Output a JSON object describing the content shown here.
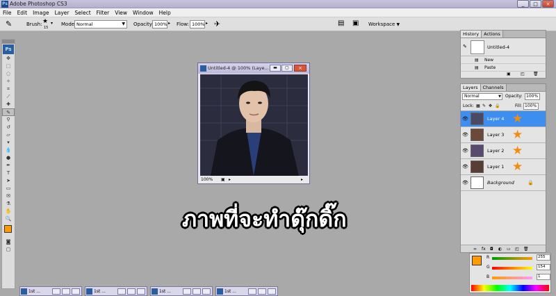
{
  "window": {
    "app_badge": "Ps",
    "title": "Adobe Photoshop CS3",
    "btn_min": "_",
    "btn_max": "□",
    "btn_close": "×"
  },
  "menu": [
    "File",
    "Edit",
    "Image",
    "Layer",
    "Select",
    "Filter",
    "View",
    "Window",
    "Help"
  ],
  "options": {
    "brush_label": "Brush:",
    "brush_size": "15",
    "mode_label": "Mode:",
    "mode_value": "Normal",
    "opacity_label": "Opacity:",
    "opacity_value": "100%",
    "flow_label": "Flow:",
    "flow_value": "100%",
    "workspace_label": "Workspace"
  },
  "toolbox": {
    "logo": "Ps"
  },
  "document": {
    "title": "Untitled-4 @ 100% (Laye...",
    "zoom": "100%"
  },
  "caption": "ภาพที่จะทำดุ๊กดิ๊ก",
  "history": {
    "tabs": [
      "History",
      "Actions"
    ],
    "snapshot": "Untitled-4",
    "states": [
      "New",
      "Paste"
    ]
  },
  "layers": {
    "tabs": [
      "Layers",
      "Channels"
    ],
    "blend_mode": "Normal",
    "opacity_label": "Opacity:",
    "opacity_value": "100%",
    "lock_label": "Lock:",
    "fill_label": "Fill:",
    "fill_value": "100%",
    "items": [
      {
        "name": "Layer 4",
        "selected": true
      },
      {
        "name": "Layer 3",
        "selected": false
      },
      {
        "name": "Layer 2",
        "selected": false
      },
      {
        "name": "Layer 1",
        "selected": false
      },
      {
        "name": "Background",
        "selected": false
      }
    ]
  },
  "color": {
    "r_label": "R",
    "r_value": "255",
    "g_label": "G",
    "g_value": "154",
    "b_label": "B",
    "b_value": "1",
    "foreground": "#ff9a01"
  },
  "minimized_docs": [
    "1st ...",
    "1st ...",
    "1st ...",
    "1st ..."
  ]
}
